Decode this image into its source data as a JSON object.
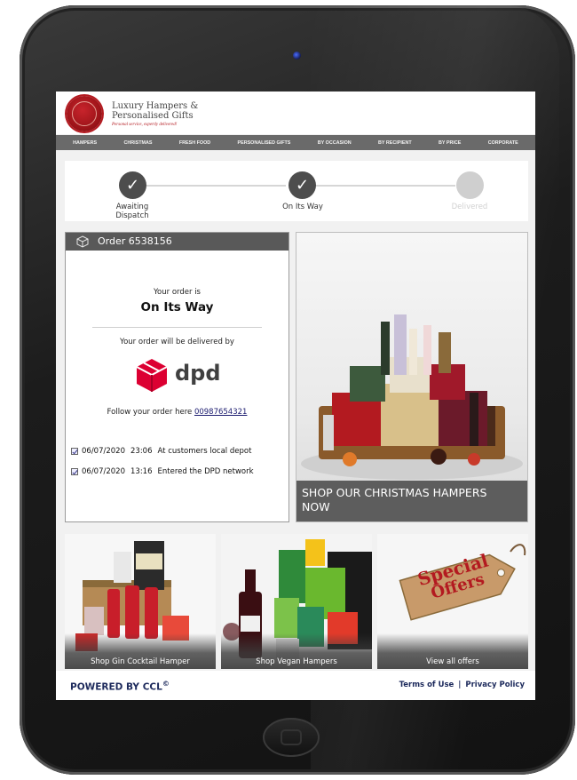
{
  "brand": {
    "line1": "Luxury Hampers &",
    "line2": "Personalised Gifts",
    "tagline": "Personal service, expertly delivered!",
    "seal_color": "#b31a20"
  },
  "nav": {
    "items": [
      "HAMPERS",
      "CHRISTMAS",
      "FRESH FOOD",
      "PERSONALISED GIFTS",
      "BY OCCASION",
      "BY RECIPIENT",
      "BY PRICE",
      "CORPORATE"
    ],
    "background": "#6a6a6a"
  },
  "tracker": {
    "steps": [
      {
        "label_line1": "Awaiting",
        "label_line2": "Dispatch",
        "state": "complete",
        "icon": "check-icon"
      },
      {
        "label_line1": "On Its Way",
        "label_line2": "",
        "state": "complete",
        "icon": "check-icon"
      },
      {
        "label_line1": "Delivered",
        "label_line2": "",
        "state": "pending",
        "icon": ""
      }
    ]
  },
  "order": {
    "title": "Order 6538156",
    "icon": "package-icon",
    "status_intro": "Your order is",
    "status": "On Its Way",
    "delivered_by_text": "Your order will be delivered by",
    "courier": "dpd",
    "courier_color": "#dc0032",
    "follow_text": "Follow your order here",
    "tracking_number": "00987654321",
    "events": [
      {
        "date": "06/07/2020",
        "time": "23:06",
        "description": "At customers local depot"
      },
      {
        "date": "06/07/2020",
        "time": "13:16",
        "description": "Entered the DPD network"
      }
    ]
  },
  "promo": {
    "main_banner": "SHOP OUR CHRISTMAS HAMPERS NOW",
    "tiles": [
      {
        "label": "Shop Gin Cocktail Hamper"
      },
      {
        "label": "Shop Vegan Hampers"
      },
      {
        "label": "View all offers"
      }
    ],
    "special_offers_line1": "Special",
    "special_offers_line2": "Offers"
  },
  "footer": {
    "powered_by": "POWERED BY",
    "powered_brand": "CCL",
    "terms": "Terms of Use",
    "separator": "|",
    "privacy": "Privacy Policy"
  }
}
